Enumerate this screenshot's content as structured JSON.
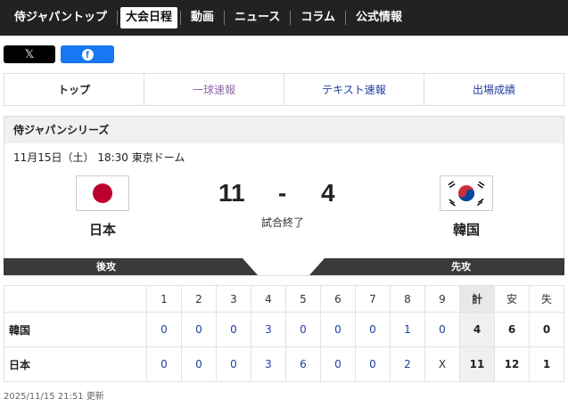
{
  "nav": {
    "items": [
      {
        "label": "侍ジャパントップ",
        "active": false
      },
      {
        "label": "大会日程",
        "active": true
      },
      {
        "label": "動画",
        "active": false
      },
      {
        "label": "ニュース",
        "active": false
      },
      {
        "label": "コラム",
        "active": false
      },
      {
        "label": "公式情報",
        "active": false
      }
    ]
  },
  "share": {
    "x_icon": "x-logo-icon",
    "facebook_icon": "facebook-icon"
  },
  "tabs": [
    "トップ",
    "一球速報",
    "テキスト速報",
    "出場成績"
  ],
  "game": {
    "series": "侍ジャパンシリーズ",
    "info": "11月15日（土） 18:30 東京ドーム",
    "home": {
      "name": "日本",
      "score": "11",
      "flag": "japan-flag-icon"
    },
    "away": {
      "name": "韓国",
      "score": "4",
      "flag": "korea-flag-icon"
    },
    "dash": "-",
    "status": "試合終了"
  },
  "band": {
    "left": "後攻",
    "right": "先攻"
  },
  "scoreboard": {
    "innings": [
      "1",
      "2",
      "3",
      "4",
      "5",
      "6",
      "7",
      "8",
      "9"
    ],
    "totals_header": [
      "計",
      "安",
      "失"
    ],
    "rows": [
      {
        "team": "韓国",
        "innings": [
          "0",
          "0",
          "0",
          "3",
          "0",
          "0",
          "0",
          "1",
          "0"
        ],
        "totals": [
          "4",
          "6",
          "0"
        ]
      },
      {
        "team": "日本",
        "innings": [
          "0",
          "0",
          "0",
          "3",
          "6",
          "0",
          "0",
          "2",
          "X"
        ],
        "totals": [
          "11",
          "12",
          "1"
        ]
      }
    ]
  },
  "updated": "2025/11/15 21:51 更新",
  "colors": {
    "nav_bg": "#222222",
    "link": "#1f3fa0",
    "facebook": "#1877f2",
    "band": "#3a3a3a"
  }
}
